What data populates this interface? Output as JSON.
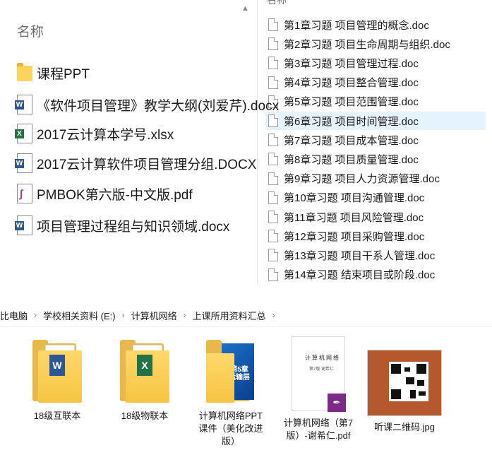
{
  "left_panel": {
    "header": "名称",
    "items": [
      {
        "label": "课程PPT",
        "icon": "folder-icon"
      },
      {
        "label": "《软件项目管理》教学大纲(刘爱芹).docx",
        "icon": "word-icon"
      },
      {
        "label": "2017云计算本学号.xlsx",
        "icon": "excel-icon"
      },
      {
        "label": "2017云计算软件项目管理分组.DOCX",
        "icon": "word-icon"
      },
      {
        "label": "PMBOK第六版-中文版.pdf",
        "icon": "pdf-icon"
      },
      {
        "label": "项目管理过程组与知识领域.docx",
        "icon": "word-icon"
      }
    ]
  },
  "right_panel": {
    "header": "名称",
    "selected_index": 5,
    "items": [
      {
        "label": "第1章习题  项目管理的概念.doc"
      },
      {
        "label": "第2章习题  项目生命周期与组织.doc"
      },
      {
        "label": "第3章习题  项目管理过程.doc"
      },
      {
        "label": "第4章习题  项目整合管理.doc"
      },
      {
        "label": "第5章习题  项目范围管理.doc"
      },
      {
        "label": "第6章习题  项目时间管理.doc"
      },
      {
        "label": "第7章习题  项目成本管理.doc"
      },
      {
        "label": "第8章习题  项目质量管理.doc"
      },
      {
        "label": "第9章习题  项目人力资源管理.doc"
      },
      {
        "label": "第10章习题  项目沟通管理.doc"
      },
      {
        "label": "第11章习题  项目风险管理.doc"
      },
      {
        "label": "第12章习题  项目采购管理.doc"
      },
      {
        "label": "第13章习题  项目干系人管理.doc"
      },
      {
        "label": "第14章习题  结束项目或阶段.doc"
      }
    ]
  },
  "breadcrumb": {
    "items": [
      "比电脑",
      "学校相关资料 (E:)",
      "计算机网络",
      "上课所用资料汇总"
    ],
    "separator": "›"
  },
  "grid": {
    "items": [
      {
        "label": "18级互联本",
        "type": "folder-word"
      },
      {
        "label": "18级物联本",
        "type": "folder-excel"
      },
      {
        "label": "计算机网络PPT课件（美化改进版）",
        "type": "folder-ppt"
      },
      {
        "label": "计算机网络（第7版）-谢希仁.pdf",
        "type": "pdf"
      },
      {
        "label": "听课二维码.jpg",
        "type": "image"
      }
    ],
    "pdf_thumb_title": "计算机网络",
    "pdf_thumb_sub": "第7版 谢希仁",
    "ppt_cover_text": "第5章 运输层"
  },
  "colors": {
    "selection": "#e5f3ff",
    "word": "#2b5797",
    "excel": "#217346",
    "pdf": "#7b2b87"
  }
}
